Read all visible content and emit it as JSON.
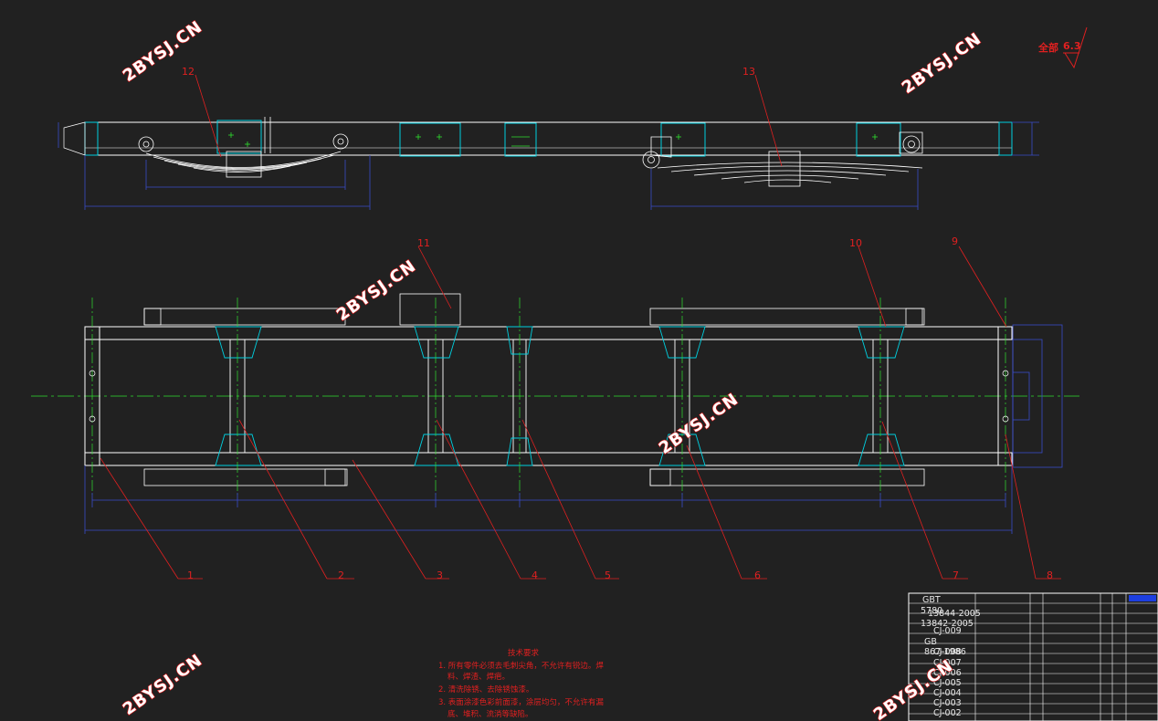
{
  "watermark": "2BYSJ.CN",
  "roughness": {
    "label": "全部",
    "value": "6.3"
  },
  "part_labels": {
    "p12": "12",
    "p13": "13",
    "p11": "11",
    "p10": "10",
    "p9": "9",
    "p1": "1",
    "p2": "2",
    "p3": "3",
    "p4": "4",
    "p5": "5",
    "p6": "6",
    "p7": "7",
    "p8": "8"
  },
  "notes": {
    "title": "技术要求",
    "line1": "1. 所有零件必须去毛刺尖角，不允许有锐边。焊",
    "line1b": "料、焊渣、焊疤。",
    "line2": "2. 清洗除锈、去除锈蚀漆。",
    "line3": "3. 表面涂漆色彩前面漆，涂层均匀，不允许有漏",
    "line3b": "底、堆积、流淌等缺陷。"
  },
  "title_block": {
    "rows": [
      "GBT",
      "5780",
      "13844-2005",
      "13842-2005",
      "CJ-009",
      "GB",
      "867-1986",
      "CJ-008",
      "CJ-007",
      "CJ-006",
      "CJ-005",
      "CJ-004",
      "CJ-003",
      "CJ-002"
    ]
  }
}
